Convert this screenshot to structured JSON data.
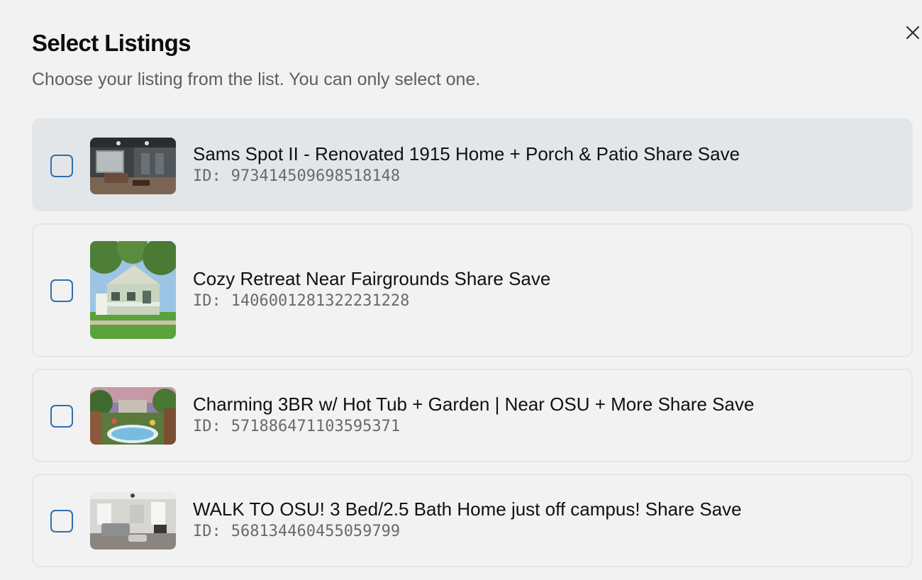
{
  "dialog": {
    "title": "Select Listings",
    "subtitle": "Choose your listing from the list. You can only select one.",
    "close_icon": "close-icon"
  },
  "listings": [
    {
      "title": "Sams Spot II - Renovated 1915 Home + Porch & Patio Share Save",
      "id_prefix": "ID:",
      "id": "973414509698518148",
      "checked": false,
      "thumbnail": "living-room-photo"
    },
    {
      "title": "Cozy Retreat Near Fairgrounds Share Save",
      "id_prefix": "ID:",
      "id": "1406001281322231228",
      "checked": false,
      "thumbnail": "house-exterior-photo"
    },
    {
      "title": "Charming 3BR w/ Hot Tub + Garden | Near OSU + More Share Save",
      "id_prefix": "ID:",
      "id": "571886471103595371",
      "checked": false,
      "thumbnail": "hot-tub-garden-photo"
    },
    {
      "title": "WALK TO OSU! 3 Bed/2.5 Bath Home just off campus! Share Save",
      "id_prefix": "ID:",
      "id": "568134460455059799",
      "checked": false,
      "thumbnail": "bright-living-room-photo"
    }
  ],
  "colors": {
    "background": "#f2f2f2",
    "hover_card": "#e3e6e8",
    "card_border": "#e6e6e6",
    "checkbox_border": "#2e6fb0",
    "subtitle": "#5e5e5e",
    "id_text": "#6a6a6a"
  }
}
